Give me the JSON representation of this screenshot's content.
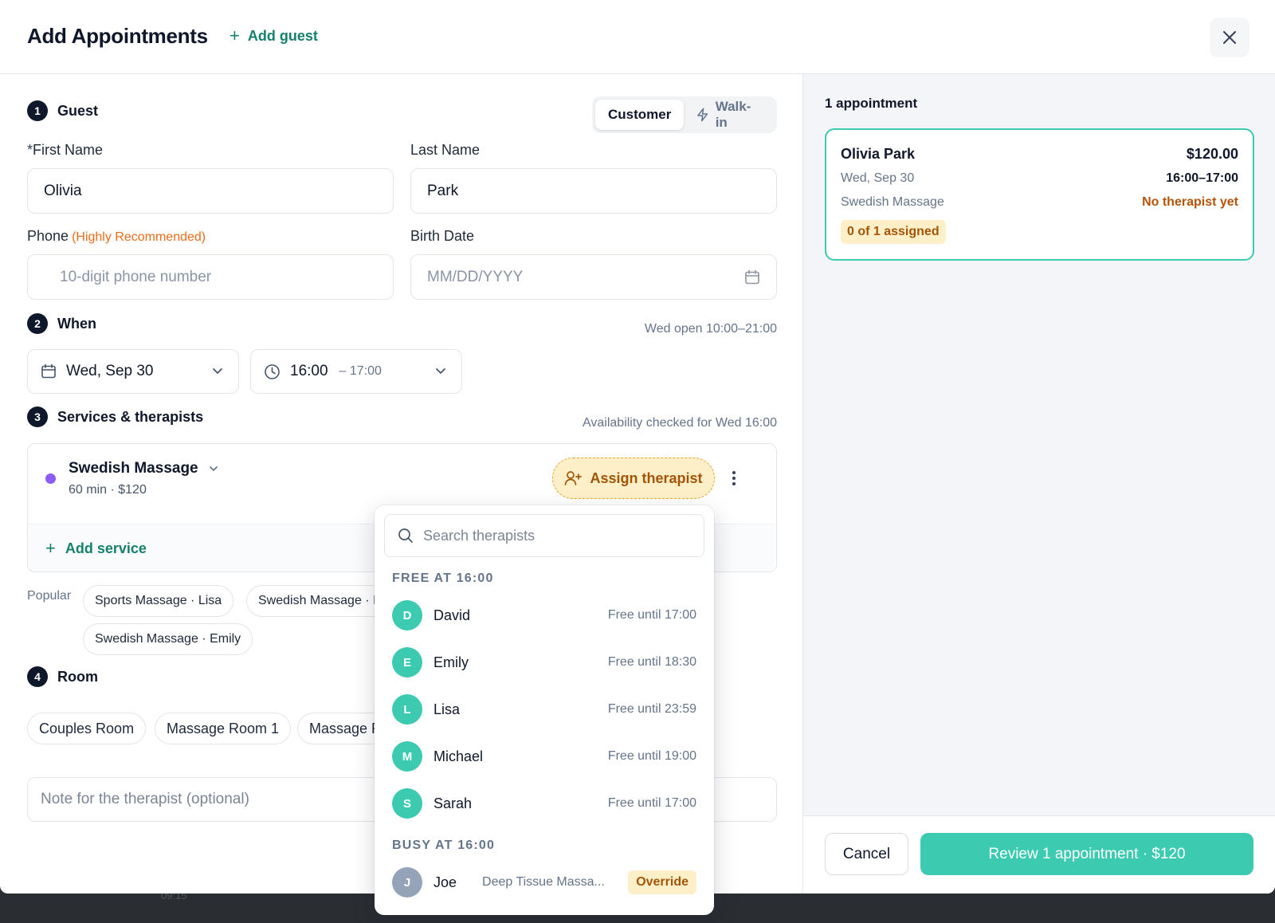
{
  "header": {
    "title": "Add Appointments",
    "add_guest": "Add guest"
  },
  "guest": {
    "step_num": "1",
    "step_label": "Guest",
    "toggle": {
      "customer": "Customer",
      "walkin": "Walk-in",
      "selected": "Customer"
    },
    "first_name_label": "First Name",
    "first_name_required_mark": "*",
    "first_name_value": "Olivia",
    "last_name_label": "Last Name",
    "last_name_value": "Park",
    "phone_label": "Phone",
    "phone_hint": "(Highly Recommended)",
    "phone_placeholder": "10-digit phone number",
    "birth_label": "Birth Date",
    "birth_placeholder": "MM/DD/YYYY"
  },
  "when": {
    "step_num": "2",
    "step_label": "When",
    "hours": "Wed open 10:00–21:00",
    "date_value": "Wed, Sep 30",
    "time_start": "16:00",
    "time_end": "– 17:00"
  },
  "services": {
    "step_num": "3",
    "step_label": "Services & therapists",
    "availability_note": "Availability checked for Wed 16:00",
    "service_name": "Swedish Massage",
    "service_meta": "60 min · $120",
    "assign_label": "Assign therapist",
    "add_service": "Add service",
    "popular_label": "Popular",
    "popular": [
      "Sports Massage · Lisa",
      "Swedish Massage · Emily",
      "Swedish Massage · Emily"
    ]
  },
  "room": {
    "step_num": "4",
    "step_label": "Room",
    "rooms": [
      "Couples Room",
      "Massage Room 1",
      "Massage Room 2"
    ]
  },
  "note_placeholder": "Note for the therapist (optional)",
  "therapist_dropdown": {
    "search_placeholder": "Search therapists",
    "free_heading": "FREE AT 16:00",
    "free": [
      {
        "initial": "D",
        "name": "David",
        "status": "Free until 17:00"
      },
      {
        "initial": "E",
        "name": "Emily",
        "status": "Free until 18:30"
      },
      {
        "initial": "L",
        "name": "Lisa",
        "status": "Free until 23:59"
      },
      {
        "initial": "M",
        "name": "Michael",
        "status": "Free until 19:00"
      },
      {
        "initial": "S",
        "name": "Sarah",
        "status": "Free until 17:00"
      }
    ],
    "busy_heading": "BUSY AT 16:00",
    "busy": [
      {
        "initial": "J",
        "name": "Joe",
        "service": "Deep Tissue Massa...",
        "action": "Override"
      }
    ]
  },
  "summary": {
    "title": "1 appointment",
    "card": {
      "name": "Olivia Park",
      "price": "$120.00",
      "date": "Wed, Sep 30",
      "time": "16:00–17:00",
      "service": "Swedish Massage",
      "therapist_status": "No therapist yet",
      "assigned": "0 of 1 assigned"
    }
  },
  "footer": {
    "cancel": "Cancel",
    "review": "Review 1 appointment · $120"
  },
  "backdrop_text": "09:15",
  "colors": {
    "accent": "#3ccab0",
    "accent_dark": "#15806c",
    "warning_bg": "#fdf0c9",
    "warning_text": "#a45407",
    "hint_orange": "#ea6c1a",
    "service_dot": "#8b5cf6"
  }
}
